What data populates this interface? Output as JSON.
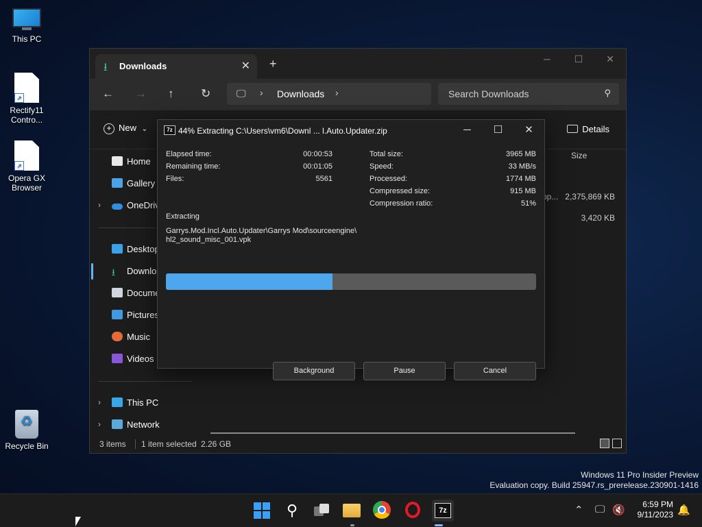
{
  "desktop": {
    "icons": [
      {
        "label": "This PC",
        "icon": "monitor-icon"
      },
      {
        "label": "Rectify11 Contro...",
        "icon": "file-shortcut-icon"
      },
      {
        "label": "Opera GX Browser",
        "icon": "file-shortcut-icon"
      },
      {
        "label": "Recycle Bin",
        "icon": "recycle-bin-icon"
      }
    ]
  },
  "explorer": {
    "tab_title": "Downloads",
    "new_tab": "+",
    "breadcrumb": "Downloads",
    "search_placeholder": "Search Downloads",
    "new_label": "New",
    "details_label": "Details",
    "column_size": "Size",
    "rows": [
      {
        "size": "2,375,869 KB",
        "name_fragment": "pp..."
      },
      {
        "size": "3,420 KB"
      }
    ],
    "sidebar": {
      "home": "Home",
      "gallery": "Gallery",
      "onedrive": "OneDrive",
      "desktop": "Desktop",
      "downloads": "Downloads",
      "documents": "Documents",
      "pictures": "Pictures",
      "music": "Music",
      "videos": "Videos",
      "this_pc": "This PC",
      "network": "Network"
    },
    "status": {
      "items": "3 items",
      "selected": "1 item selected",
      "size": "2.26 GB"
    }
  },
  "dialog": {
    "title": "44% Extracting C:\\Users\\vm6\\Downl ... l.Auto.Updater.zip",
    "logo": "7z",
    "left_stats": [
      {
        "label": "Elapsed time:",
        "value": "00:00:53"
      },
      {
        "label": "Remaining time:",
        "value": "00:01:05"
      },
      {
        "label": "Files:",
        "value": "5561"
      }
    ],
    "right_stats": [
      {
        "label": "Total size:",
        "value": "3965 MB"
      },
      {
        "label": "Speed:",
        "value": "33 MB/s"
      },
      {
        "label": "Processed:",
        "value": "1774 MB"
      },
      {
        "label": "Compressed size:",
        "value": "915 MB"
      },
      {
        "label": "Compression ratio:",
        "value": "51%"
      }
    ],
    "action": "Extracting",
    "path_line1": "Garrys.Mod.Incl.Auto.Updater\\Garrys Mod\\sourceengine\\",
    "path_line2": "hl2_sound_misc_001.vpk",
    "progress": 0.45,
    "buttons": {
      "background": "Background",
      "pause": "Pause",
      "cancel": "Cancel"
    }
  },
  "watermark": {
    "line1": "Windows 11 Pro Insider Preview",
    "line2": "Evaluation copy. Build 25947.rs_prerelease.230901-1416"
  },
  "taskbar": {
    "time": "6:59 PM",
    "date": "9/11/2023",
    "pinned": [
      "start-icon",
      "search-icon",
      "task-view-icon",
      "file-explorer-icon",
      "chrome-icon",
      "opera-icon",
      "7zip-icon"
    ],
    "sevenzip_label": "7z"
  },
  "colors": {
    "accent": "#4ea6ec",
    "progress_track": "#5a5a5a",
    "downloads_icon": "#3cc48a"
  }
}
